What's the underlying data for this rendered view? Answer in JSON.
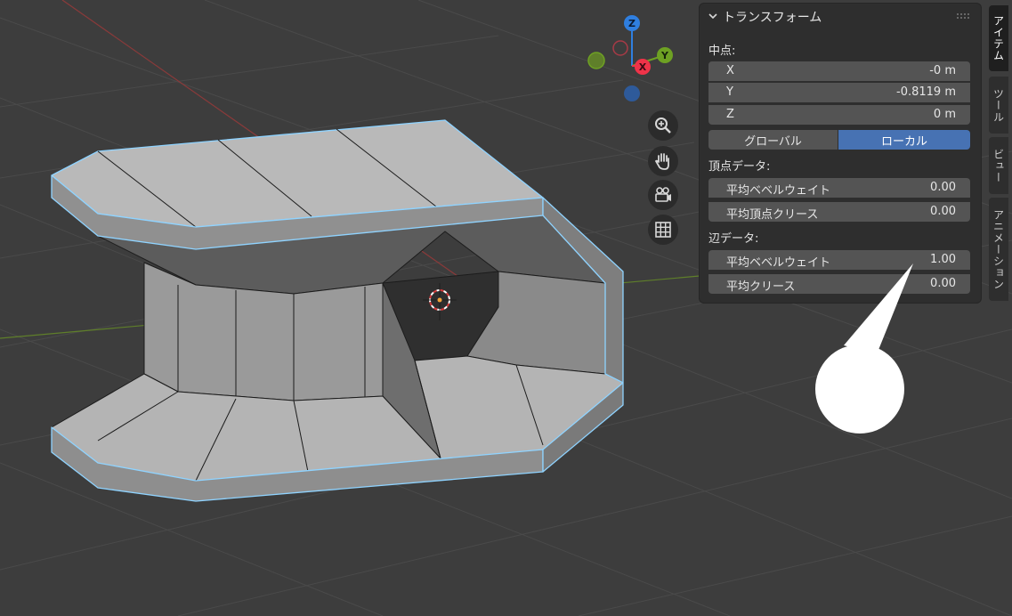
{
  "viewport": {
    "nav_buttons": [
      {
        "name": "zoom-icon"
      },
      {
        "name": "hand-pan-icon"
      },
      {
        "name": "camera-view-icon"
      },
      {
        "name": "grid-ortho-icon"
      }
    ],
    "gizmo": {
      "z_label": "Z",
      "y_label": "Y",
      "x_label": "X",
      "colors": {
        "z": "#2f7fe0",
        "y": "#6ea123",
        "x": "#ef3349"
      }
    }
  },
  "panel": {
    "title": "トランスフォーム",
    "median_label": "中点:",
    "median": [
      {
        "axis": "X",
        "value": "-0 m"
      },
      {
        "axis": "Y",
        "value": "-0.8119 m"
      },
      {
        "axis": "Z",
        "value": "0 m"
      }
    ],
    "space_global": "グローバル",
    "space_local": "ローカル",
    "vertex_data_label": "頂点データ:",
    "vertex_bevel_label": "平均ベベルウェイト",
    "vertex_bevel_value": "0.00",
    "vertex_crease_label": "平均頂点クリース",
    "vertex_crease_value": "0.00",
    "edge_data_label": "辺データ:",
    "edge_bevel_label": "平均ベベルウェイト",
    "edge_bevel_value": "1.00",
    "edge_crease_label": "平均クリース",
    "edge_crease_value": "0.00"
  },
  "side_tabs": [
    "アイテム",
    "ツール",
    "ビュー",
    "アニメーション"
  ],
  "colors": {
    "accent": "#4772b3",
    "selection_edge": "#8fd3ff"
  }
}
